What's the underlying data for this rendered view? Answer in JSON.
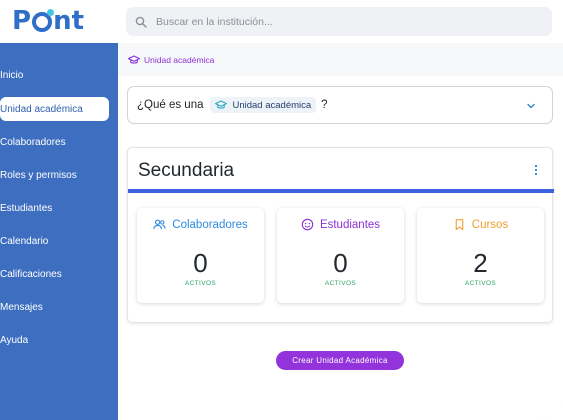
{
  "app": {
    "logo_prefix": "P",
    "logo_suffix": "nt",
    "brand_color": "#2f6fc7",
    "accent_dot_color": "#43c6e6"
  },
  "search": {
    "placeholder": "Buscar en la institución...",
    "value": "",
    "icon": "search-icon"
  },
  "sidebar": {
    "color": "#3d6ebf",
    "items": [
      {
        "label": "Inicio",
        "active": false
      },
      {
        "label": "Unidad académica",
        "active": true
      },
      {
        "label": "Colaboradores",
        "active": false
      },
      {
        "label": "Roles y permisos",
        "active": false
      },
      {
        "label": "Estudiantes",
        "active": false
      },
      {
        "label": "Calendario",
        "active": false
      },
      {
        "label": "Calificaciones",
        "active": false
      },
      {
        "label": "Mensajes",
        "active": false
      },
      {
        "label": "Ayuda",
        "active": false
      }
    ]
  },
  "breadcrumb": {
    "label": "Unidad académica",
    "icon": "graduation-cap-icon",
    "color": "#8a32d6"
  },
  "faq": {
    "prefix": "¿Qué es una",
    "pill_label": "Unidad académica",
    "suffix": "?",
    "icon": "graduation-cap-icon"
  },
  "unit_card": {
    "title": "Secundaria",
    "bar_color": "#3d63e3",
    "stats": [
      {
        "label": "Colaboradores",
        "value": "0",
        "sub": "ACTIVOS",
        "icon": "users-icon",
        "color": "#2f8be0"
      },
      {
        "label": "Estudiantes",
        "value": "0",
        "sub": "ACTIVOS",
        "icon": "smile-icon",
        "color": "#8a32d6"
      },
      {
        "label": "Cursos",
        "value": "2",
        "sub": "ACTIVOS",
        "icon": "bookmark-icon",
        "color": "#f0a030"
      }
    ]
  },
  "create_button": {
    "label": "Crear Unidad Académica",
    "color": "#9233dc"
  }
}
